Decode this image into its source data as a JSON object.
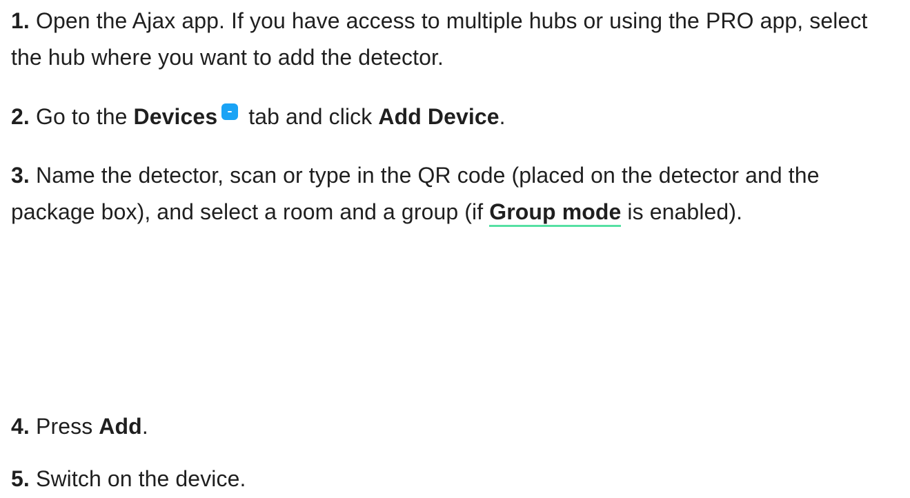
{
  "steps": [
    {
      "number": "1.",
      "text": "Open the Ajax app. If you have access to multiple hubs or using the PRO app, select the hub where you want to add the detector."
    },
    {
      "number": "2.",
      "parts": {
        "a": "Go to the ",
        "devices": "Devices",
        "b": " tab and click ",
        "add_device": "Add Device",
        "c": "."
      },
      "icon": "devices-tab-icon"
    },
    {
      "number": "3.",
      "parts": {
        "a": "Name the detector, scan or type in the QR code (placed on the detector and the package box), and select a room and a group (if ",
        "link": "Group mode",
        "b": " is enabled)."
      }
    },
    {
      "number": "4.",
      "parts": {
        "a": "Press ",
        "add": "Add",
        "b": "."
      }
    },
    {
      "number": "5.",
      "text": "Switch on the device."
    }
  ],
  "colors": {
    "text": "#1f1f1f",
    "icon_blue": "#1aa3f5",
    "link_underline": "#56e0a3"
  }
}
